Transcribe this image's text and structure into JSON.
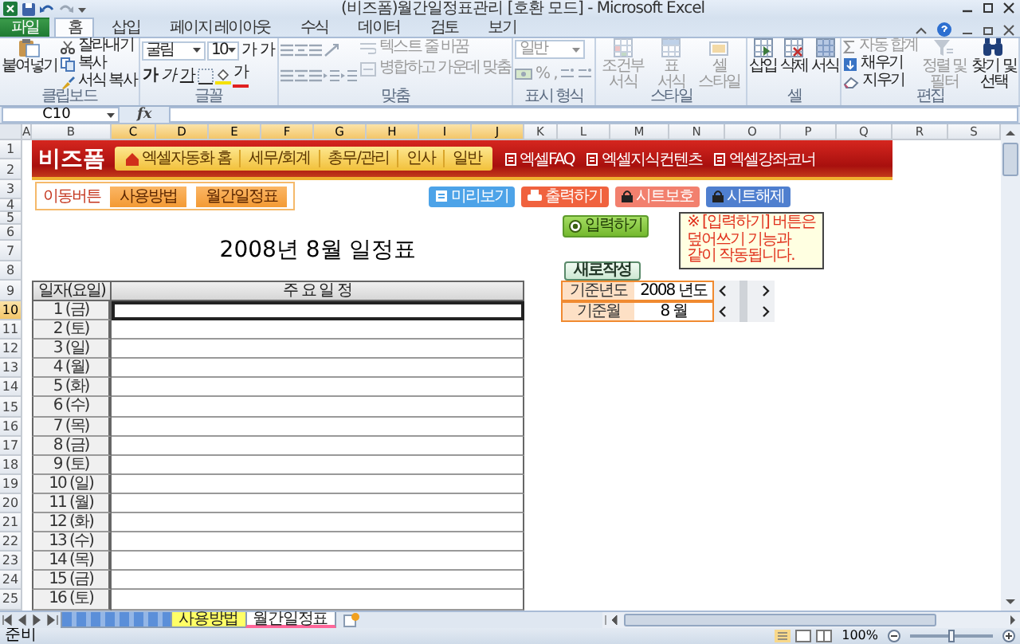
{
  "window": {
    "title": "(비즈폼)월간일정표관리 [호환 모드] - Microsoft Excel"
  },
  "tabs": [
    {
      "label": "파일",
      "kind": "file",
      "selected": false
    },
    {
      "label": "홈",
      "kind": "tab",
      "selected": true
    },
    {
      "label": "삽입",
      "kind": "tab",
      "selected": false
    },
    {
      "label": "페이지 레이아웃",
      "kind": "tab",
      "selected": false
    },
    {
      "label": "수식",
      "kind": "tab",
      "selected": false
    },
    {
      "label": "데이터",
      "kind": "tab",
      "selected": false
    },
    {
      "label": "검토",
      "kind": "tab",
      "selected": false
    },
    {
      "label": "보기",
      "kind": "tab",
      "selected": false
    }
  ],
  "ribbon": {
    "groups": [
      {
        "kind": "clipboard",
        "label": "클립보드",
        "items": [
          {
            "label": "붙여넣기",
            "disabled": false
          },
          {
            "label": "잘라내기",
            "disabled": false
          },
          {
            "label": "복사",
            "disabled": false
          },
          {
            "label": "서식 복사",
            "disabled": false
          }
        ]
      },
      {
        "kind": "font",
        "label": "글꼴",
        "items": [
          {
            "value": "굴림",
            "disabled": false
          },
          {
            "value": "10",
            "disabled": false
          },
          {
            "label": "가",
            "disabled": false
          },
          {
            "label": "가",
            "disabled": false
          },
          {
            "label": "가",
            "disabled": false
          },
          {
            "label": "가",
            "disabled": false
          },
          {
            "label": "가",
            "disabled": false
          },
          {
            "label": "가",
            "disabled": false
          }
        ]
      },
      {
        "kind": "alignment",
        "label": "맞춤",
        "items": [
          {
            "label": "텍스트 줄 바꿈",
            "disabled": true
          },
          {
            "label": "병합하고 가운데 맞춤",
            "disabled": true
          }
        ]
      },
      {
        "kind": "number",
        "label": "표시 형식",
        "items": [
          {
            "value": "일반",
            "disabled": true
          },
          {
            "label": "%",
            "disabled": true
          },
          {
            "label": ",",
            "disabled": true
          }
        ]
      },
      {
        "kind": "styles",
        "label": "스타일",
        "items": [
          {
            "label": "조건부 서식",
            "disabled": true
          },
          {
            "label": "표 서식",
            "disabled": true
          },
          {
            "label": "셀 스타일",
            "disabled": true
          }
        ]
      },
      {
        "kind": "cells",
        "label": "셀",
        "items": [
          {
            "label": "삽입",
            "disabled": false
          },
          {
            "label": "삭제",
            "disabled": false
          },
          {
            "label": "서식",
            "disabled": false
          }
        ]
      },
      {
        "kind": "editing",
        "label": "편집",
        "items": [
          {
            "label": "자동 합계",
            "disabled": true
          },
          {
            "label": "채우기",
            "disabled": false
          },
          {
            "label": "지우기",
            "disabled": false
          },
          {
            "label": "정렬 및 필터",
            "disabled": true
          },
          {
            "label": "찾기 및 선택",
            "disabled": false
          }
        ]
      }
    ]
  },
  "formula_bar": {
    "name_box": "C10",
    "function_label": "fx"
  },
  "sheet": {
    "columns": [
      {
        "label": "A",
        "selected": false
      },
      {
        "label": "B",
        "selected": false
      },
      {
        "label": "C",
        "selected": true
      },
      {
        "label": "D",
        "selected": true
      },
      {
        "label": "E",
        "selected": true
      },
      {
        "label": "F",
        "selected": true
      },
      {
        "label": "G",
        "selected": true
      },
      {
        "label": "H",
        "selected": true
      },
      {
        "label": "I",
        "selected": true
      },
      {
        "label": "J",
        "selected": true
      },
      {
        "label": "K",
        "selected": false
      },
      {
        "label": "L",
        "selected": false
      },
      {
        "label": "M",
        "selected": false
      },
      {
        "label": "N",
        "selected": false
      },
      {
        "label": "O",
        "selected": false
      },
      {
        "label": "P",
        "selected": false
      },
      {
        "label": "Q",
        "selected": false
      },
      {
        "label": "R",
        "selected": false
      },
      {
        "label": "S",
        "selected": false
      }
    ],
    "rows": [
      {
        "label": "1",
        "selected": false
      },
      {
        "label": "2",
        "selected": false
      },
      {
        "label": "3",
        "selected": false
      },
      {
        "label": "4",
        "selected": false
      },
      {
        "label": "5",
        "selected": false
      },
      {
        "label": "6",
        "selected": false
      },
      {
        "label": "7",
        "selected": false
      },
      {
        "label": "8",
        "selected": false
      },
      {
        "label": "9",
        "selected": false
      },
      {
        "label": "10",
        "selected": true
      },
      {
        "label": "11",
        "selected": false
      },
      {
        "label": "12",
        "selected": false
      },
      {
        "label": "13",
        "selected": false
      },
      {
        "label": "14",
        "selected": false
      },
      {
        "label": "15",
        "selected": false
      },
      {
        "label": "16",
        "selected": false
      },
      {
        "label": "17",
        "selected": false
      },
      {
        "label": "18",
        "selected": false
      },
      {
        "label": "19",
        "selected": false
      },
      {
        "label": "20",
        "selected": false
      },
      {
        "label": "21",
        "selected": false
      },
      {
        "label": "22",
        "selected": false
      },
      {
        "label": "23",
        "selected": false
      },
      {
        "label": "24",
        "selected": false
      },
      {
        "label": "25",
        "selected": false
      }
    ],
    "banner": {
      "logo": "비즈폼",
      "nav": [
        {
          "label": "엑셀자동화 홈",
          "kind": "home"
        },
        {
          "label": "세무/회계",
          "kind": "link"
        },
        {
          "label": "총무/관리",
          "kind": "link"
        },
        {
          "label": "인사",
          "kind": "link"
        },
        {
          "label": "일반",
          "kind": "link"
        }
      ],
      "links": [
        "엑셀FAQ",
        "엑셀지식컨텐츠",
        "엑셀강좌코너"
      ]
    },
    "move_box": {
      "label": "이동버튼",
      "buttons": [
        "사용방법",
        "월간일정표"
      ]
    },
    "action_buttons": [
      {
        "label": "미리보기",
        "kind": "preview"
      },
      {
        "label": "출력하기",
        "kind": "print"
      },
      {
        "label": "시트보호",
        "kind": "protect"
      },
      {
        "label": "시트해제",
        "kind": "unprotect"
      }
    ],
    "input_button": "입력하기",
    "note": {
      "lines": [
        "※ [입력하기] 버튼은",
        "덮어쓰기 기능과",
        "같이 작동됩니다."
      ]
    },
    "new_button": "새로작성",
    "title": "2008년 8월 일정표",
    "table": {
      "columns": [
        "일자(요일)",
        "주 요 일 정"
      ],
      "rows": [
        {
          "date": "1 (금)",
          "selected": true
        },
        {
          "date": "2 (토)",
          "selected": false
        },
        {
          "date": "3 (일)",
          "selected": false
        },
        {
          "date": "4 (월)",
          "selected": false
        },
        {
          "date": "5 (화)",
          "selected": false
        },
        {
          "date": "6 (수)",
          "selected": false
        },
        {
          "date": "7 (목)",
          "selected": false
        },
        {
          "date": "8 (금)",
          "selected": false
        },
        {
          "date": "9 (토)",
          "selected": false
        },
        {
          "date": "10 (일)",
          "selected": false
        },
        {
          "date": "11 (월)",
          "selected": false
        },
        {
          "date": "12 (화)",
          "selected": false
        },
        {
          "date": "13 (수)",
          "selected": false
        },
        {
          "date": "14 (목)",
          "selected": false
        },
        {
          "date": "15 (금)",
          "selected": false
        },
        {
          "date": "16 (토)",
          "selected": false
        }
      ]
    },
    "settings": [
      {
        "label": "기준년도",
        "value": "2008 년도"
      },
      {
        "label": "기준월",
        "value": "8 월"
      }
    ]
  },
  "sheet_tabs": [
    {
      "kind": "image",
      "color": "#5b8fd9",
      "selected": false
    },
    {
      "kind": "text",
      "label": "사용방법",
      "color": "#ffff66",
      "selected": false
    },
    {
      "kind": "text",
      "label": "월간일정표",
      "color": "#ff6699",
      "selected": true
    }
  ],
  "status_bar": {
    "text": "준비",
    "zoom": {
      "label": "100%",
      "level": 0.5
    }
  }
}
